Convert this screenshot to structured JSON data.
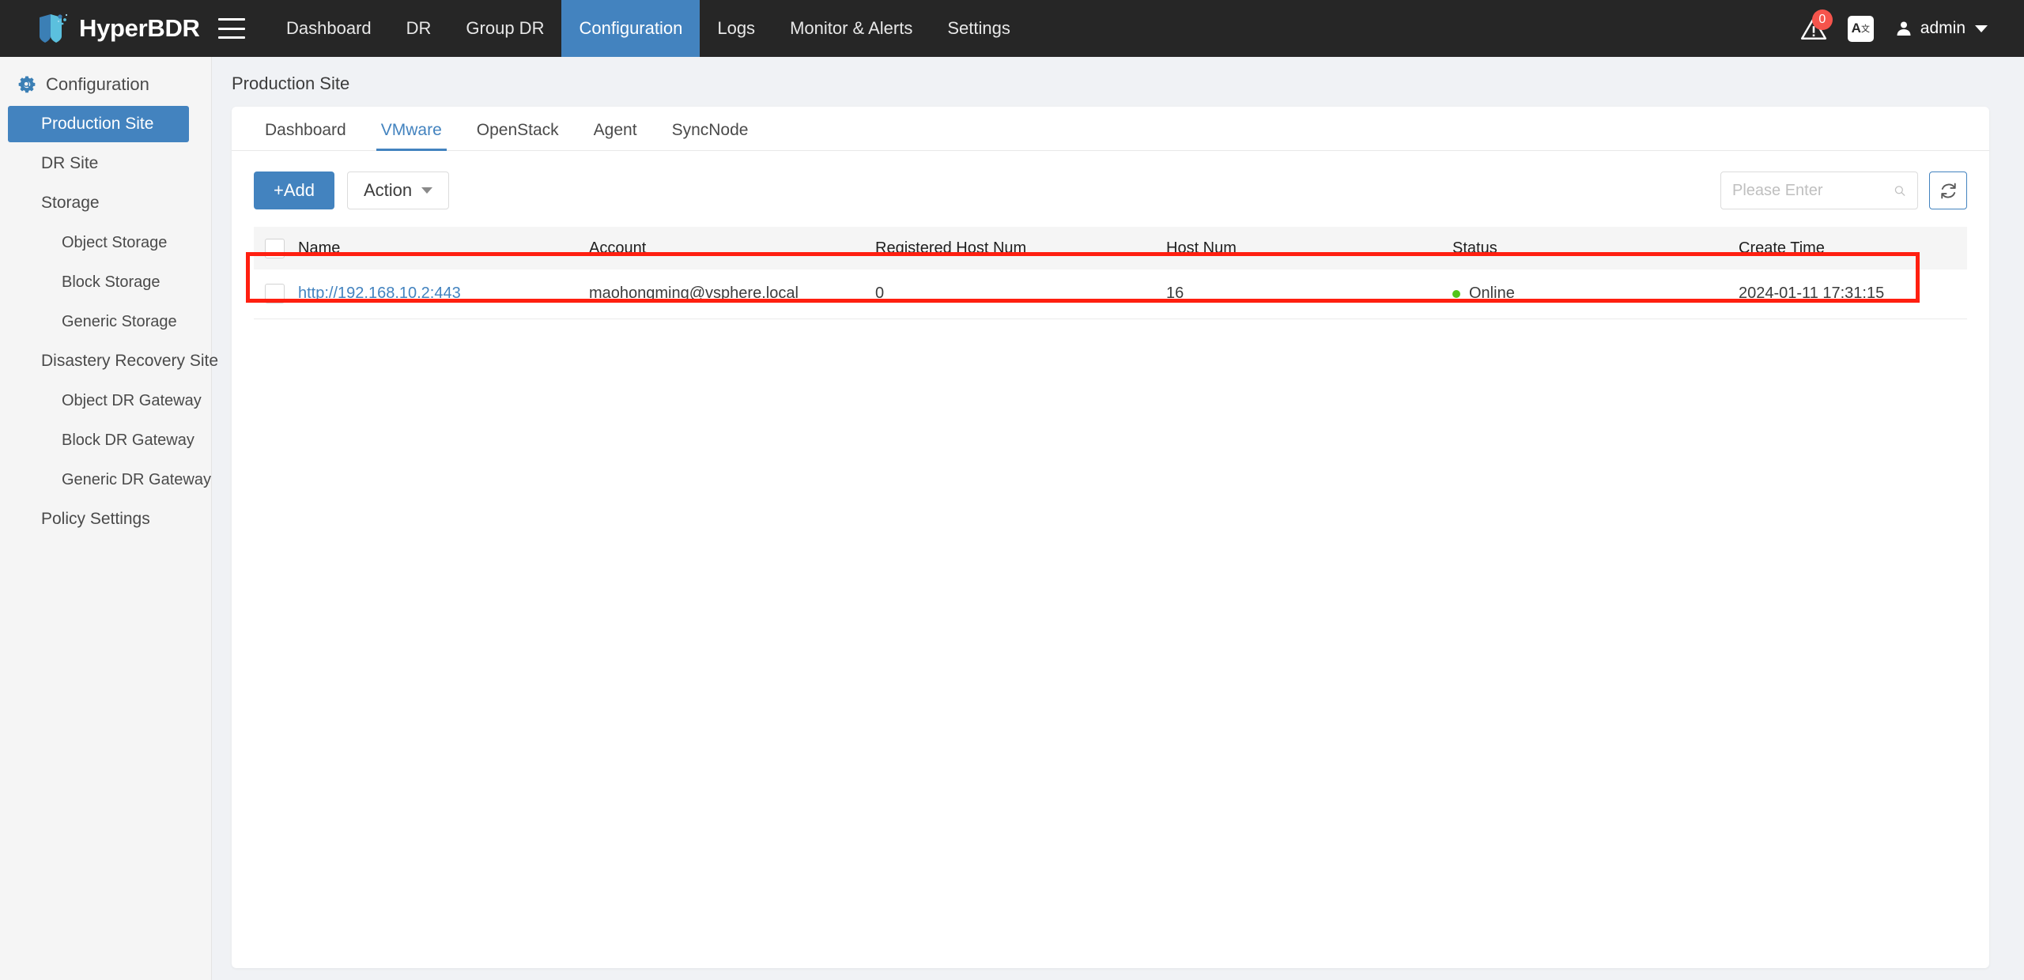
{
  "header": {
    "brand": "HyperBDR",
    "menu_icon": "hamburger-icon",
    "nav": [
      {
        "label": "Dashboard",
        "active": false
      },
      {
        "label": "DR",
        "active": false
      },
      {
        "label": "Group DR",
        "active": false
      },
      {
        "label": "Configuration",
        "active": true
      },
      {
        "label": "Logs",
        "active": false
      },
      {
        "label": "Monitor & Alerts",
        "active": false
      },
      {
        "label": "Settings",
        "active": false
      }
    ],
    "alert_badge_count": "0",
    "lang_label": "A",
    "lang_sup": "文",
    "user_name": "admin",
    "active_nav_color": "#4383bf",
    "bar_color": "#262626"
  },
  "sidebar": {
    "title": "Configuration",
    "items": [
      {
        "label": "Production Site",
        "level": 1,
        "active": true
      },
      {
        "label": "DR Site",
        "level": 1,
        "active": false
      },
      {
        "label": "Storage",
        "level": 1,
        "active": false
      },
      {
        "label": "Object Storage",
        "level": 2,
        "active": false
      },
      {
        "label": "Block Storage",
        "level": 2,
        "active": false
      },
      {
        "label": "Generic Storage",
        "level": 2,
        "active": false
      },
      {
        "label": "Disastery Recovery Site",
        "level": 1,
        "active": false
      },
      {
        "label": "Object DR Gateway",
        "level": 2,
        "active": false
      },
      {
        "label": "Block DR Gateway",
        "level": 2,
        "active": false
      },
      {
        "label": "Generic DR Gateway",
        "level": 2,
        "active": false
      },
      {
        "label": "Policy Settings",
        "level": 1,
        "active": false
      }
    ]
  },
  "main": {
    "page_title": "Production Site",
    "tabs": [
      {
        "label": "Dashboard",
        "active": false
      },
      {
        "label": "VMware",
        "active": true
      },
      {
        "label": "OpenStack",
        "active": false
      },
      {
        "label": "Agent",
        "active": false
      },
      {
        "label": "SyncNode",
        "active": false
      }
    ],
    "toolbar": {
      "add_label": "+Add",
      "action_label": "Action",
      "search_placeholder": "Please Enter",
      "search_value": "",
      "refresh_icon": "refresh-icon"
    },
    "table": {
      "columns": [
        "Name",
        "Account",
        "Registered Host Num",
        "Host Num",
        "Status",
        "Create Time"
      ],
      "rows": [
        {
          "name": "http://192.168.10.2:443",
          "account": "maohongming@vsphere.local",
          "registered_host_num": "0",
          "host_num": "16",
          "status": "Online",
          "status_color": "#52c41a",
          "create_time": "2024-01-11 17:31:15",
          "highlighted": true
        }
      ]
    },
    "annotation": {
      "type": "red-rectangle-highlight",
      "color": "#ff1f10"
    }
  }
}
